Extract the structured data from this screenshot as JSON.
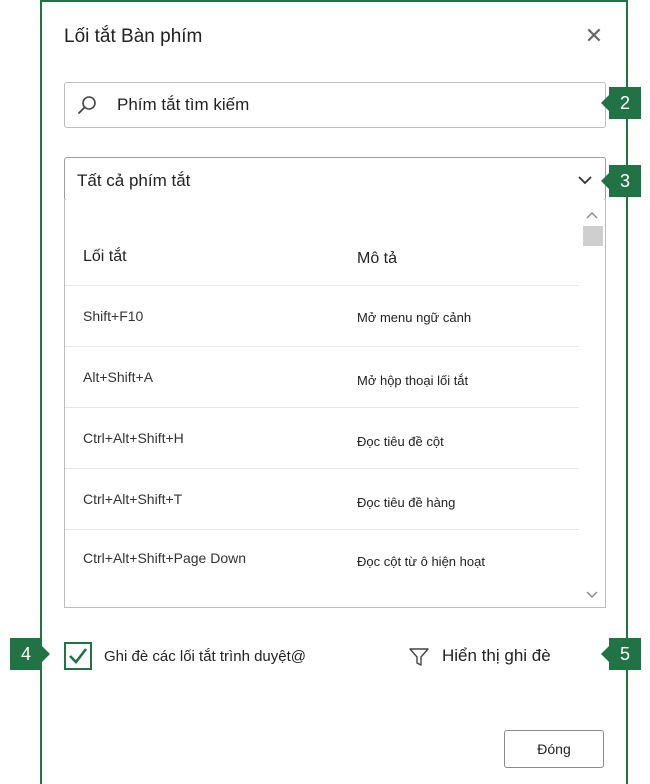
{
  "dialog": {
    "title": "Lối tắt Bàn phím",
    "close_glyph": "✕"
  },
  "search": {
    "placeholder": "Phím tắt tìm kiếm",
    "icon": "search-icon"
  },
  "filter_dropdown": {
    "selected": "Tất cả phím tắt"
  },
  "table": {
    "headers": {
      "shortcut": "Lối tắt",
      "description": "Mô tả"
    },
    "rows": [
      {
        "shortcut": "Shift+F10",
        "description": "Mở menu ngữ cảnh"
      },
      {
        "shortcut": "Alt+Shift+A",
        "description": "Mở hộp thoại lối tắt"
      },
      {
        "shortcut": "Ctrl+Alt+Shift+H",
        "description": "Đọc tiêu đề cột"
      },
      {
        "shortcut": "Ctrl+Alt+Shift+T",
        "description": "Đọc tiêu đề hàng"
      },
      {
        "shortcut": "Ctrl+Alt+Shift+Page Down",
        "description": "Đọc cột từ ô hiện hoạt"
      }
    ]
  },
  "override": {
    "checked": true,
    "label": "Ghi đè các lối tắt trình duyệt@"
  },
  "show_overrides": {
    "label": "Hiển thị ghi đè"
  },
  "footer": {
    "close_label": "Đóng"
  },
  "callouts": {
    "search": "2",
    "dropdown": "3",
    "checkbox": "4",
    "show_overrides": "5"
  },
  "colors": {
    "accent": "#217346"
  }
}
